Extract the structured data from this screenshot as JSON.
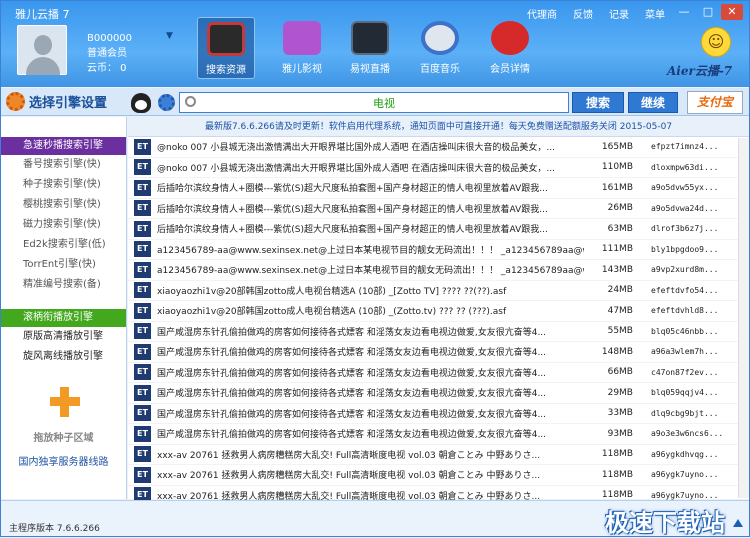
{
  "window": {
    "title": "雅儿云播 7"
  },
  "top_menu": [
    "代理商",
    "反馈",
    "记录",
    "菜单"
  ],
  "win_buttons": [
    "—",
    "□",
    "✕"
  ],
  "user": {
    "name": "B000000",
    "level": "普通会员",
    "coins": "云币： 0"
  },
  "nav": [
    {
      "label": "搜索资源",
      "icon": "movie-clapper-icon",
      "color": "#c23a3a"
    },
    {
      "label": "雅儿影视",
      "icon": "video-folder-icon",
      "color": "#b054d0"
    },
    {
      "label": "易视直播",
      "icon": "tv-screen-icon",
      "color": "#222a36"
    },
    {
      "label": "百度音乐",
      "icon": "headphones-icon",
      "color": "#3c72c8"
    },
    {
      "label": "会员详情",
      "icon": "vip-badge-icon",
      "color": "#d62a2a"
    }
  ],
  "logo": {
    "text": "Aier云播-7"
  },
  "toolbar": {
    "settings_label": "选择引擎设置",
    "search_value": "电视",
    "search_button": "搜索",
    "continue_button": "继续",
    "alipay_label": "支付宝"
  },
  "sidebar": {
    "section1": "急速秒播搜索引擎",
    "engines1": [
      "番号搜索引擎(快)",
      "种子搜索引擎(快)",
      "樱桃搜索引擎(快)",
      "磁力搜索引擎(快)",
      "Ed2k搜索引擎(低)",
      "TorrEnt引擎(快)",
      "精准编号搜索(备)"
    ],
    "section2": "滚柄衔播放引擎",
    "engines2": [
      "原版高清播放引擎",
      "旋风离线播放引擎"
    ],
    "drop_label": "拖放种子区域",
    "server_link": "国内独享服务器线路"
  },
  "notice": "最新版7.6.6.266请及时更新！软件启用代理系统，通知页面中可直接开通！每天免费赠送配额服务关闭 2015-05-07",
  "results": [
    {
      "icon": "ET",
      "name": "@noko 007 小县城无浇出激情满出大开眼界堪比国外成人酒吧 在酒店操叫床很大音的极品美女，...",
      "size": "165MB",
      "hash": "efpzt7imnz4..."
    },
    {
      "icon": "ET",
      "name": "@noko 007 小县城无浇出激情满出大开眼界堪比国外成人酒吧 在酒店操叫床很大音的极品美女，...",
      "size": "110MB",
      "hash": "dloxmpw63di..."
    },
    {
      "icon": "ET",
      "name": "后插哈尔滨纹身情人+圈模---紫优(S)超大尺度私拍套图+国产身材超正的情人电视里放着AV跟我...",
      "size": "161MB",
      "hash": "a9o5dvw55yx..."
    },
    {
      "icon": "ET",
      "name": "后插哈尔滨纹身情人+圈模---紫优(S)超大尺度私拍套图+国产身材超正的情人电视里放着AV跟我...",
      "size": "26MB",
      "hash": "a9o5dvwa24d..."
    },
    {
      "icon": "ET",
      "name": "后插哈尔滨纹身情人+圈模---紫优(S)超大尺度私拍套图+国产身材超正的情人电视里放着AV跟我...",
      "size": "63MB",
      "hash": "dlrof3b6z7j..."
    },
    {
      "icon": "ET",
      "name": "a123456789-aa@www.sexinsex.net@上过日本某电视节目的靓女无码流出！！！ _a123456789aa@ww...",
      "size": "111MB",
      "hash": "bly1bpgdoo9..."
    },
    {
      "icon": "ET",
      "name": "a123456789-aa@www.sexinsex.net@上过日本某电视节目的靓女无码流出！！！ _a123456789aa@ww...",
      "size": "143MB",
      "hash": "a9vp2xurd8m..."
    },
    {
      "icon": "ET",
      "name": "xiaoyaozhi1v@20部韩国zotto成人电视台精选A (10部) _[Zotto TV] ???? ??(??).asf",
      "size": "24MB",
      "hash": "efeftdvfo54..."
    },
    {
      "icon": "ET",
      "name": "xiaoyaozhi1v@20部韩国zotto成人电视台精选A (10部) _(Zotto.tv) ??? ?? (???).asf",
      "size": "47MB",
      "hash": "efeftdvhld8..."
    },
    {
      "icon": "ET",
      "name": "国产咸湿房东针孔偷拍做鸡的房客如何接待各式嫖客 和淫荡女友边看电视边做爱,女友很亢奋等4...",
      "size": "55MB",
      "hash": "blq05c46nbb..."
    },
    {
      "icon": "ET",
      "name": "国产咸湿房东针孔偷拍做鸡的房客如何接待各式嫖客 和淫荡女友边看电视边做爱,女友很亢奋等4...",
      "size": "148MB",
      "hash": "a96a3wlem7h..."
    },
    {
      "icon": "ET",
      "name": "国产咸湿房东针孔偷拍做鸡的房客如何接待各式嫖客 和淫荡女友边看电视边做爱,女友很亢奋等4...",
      "size": "66MB",
      "hash": "c47on87f2ev..."
    },
    {
      "icon": "ET",
      "name": "国产咸湿房东针孔偷拍做鸡的房客如何接待各式嫖客 和淫荡女友边看电视边做爱,女友很亢奋等4...",
      "size": "29MB",
      "hash": "blq059qqjv4..."
    },
    {
      "icon": "ET",
      "name": "国产咸湿房东针孔偷拍做鸡的房客如何接待各式嫖客 和淫荡女友边看电视边做爱,女友很亢奋等4...",
      "size": "33MB",
      "hash": "dlq9cbg9bjt..."
    },
    {
      "icon": "ET",
      "name": "国产咸湿房东针孔偷拍做鸡的房客如何接待各式嫖客 和淫荡女友边看电视边做爱,女友很亢奋等4...",
      "size": "93MB",
      "hash": "a9o3e3w6ncs6..."
    },
    {
      "icon": "ET",
      "name": "xxx-av 20761 拯救男人病房糟糕房大乱交! Full高清晰度电视 vol.03 朝倉ことみ 中野ありさ...",
      "size": "118MB",
      "hash": "a96ygkdhvqg..."
    },
    {
      "icon": "ET",
      "name": "xxx-av 20761 拯救男人病房糟糕房大乱交! Full高清晰度电视 vol.03 朝倉ことみ 中野ありさ...",
      "size": "118MB",
      "hash": "a96ygk7uyno..."
    },
    {
      "icon": "ET",
      "name": "xxx-av 20761 拯救男人病房糟糕房大乱交! Full高清晰度电视 vol.03 朝倉ことみ 中野ありさ...",
      "size": "118MB",
      "hash": "a96ygk7uyno..."
    }
  ],
  "status": {
    "version": "主程序版本 7.6.6.266"
  },
  "watermark": "极速下载站"
}
